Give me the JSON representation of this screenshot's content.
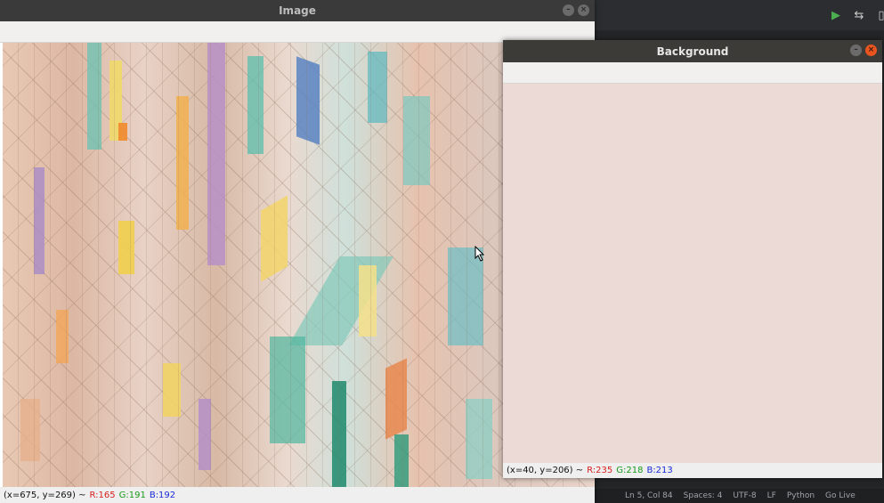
{
  "image_window": {
    "title": "Image",
    "status": {
      "coords": "(x=675, y=269) ~",
      "r": "R:165",
      "g": "G:191",
      "b": "B:192"
    }
  },
  "background_window": {
    "title": "Background",
    "fill_color": "#ebdad5",
    "status": {
      "coords": "(x=40, y=206) ~",
      "r": "R:235",
      "g": "G:218",
      "b": "B:213"
    }
  },
  "ide": {
    "status": {
      "position": "Ln 5, Col 84",
      "spaces": "Spaces: 4",
      "encoding": "UTF-8",
      "eol": "LF",
      "language": "Python",
      "live": "Go Live"
    },
    "icons": [
      "run-icon",
      "source-control-icon",
      "split-editor-icon"
    ]
  }
}
